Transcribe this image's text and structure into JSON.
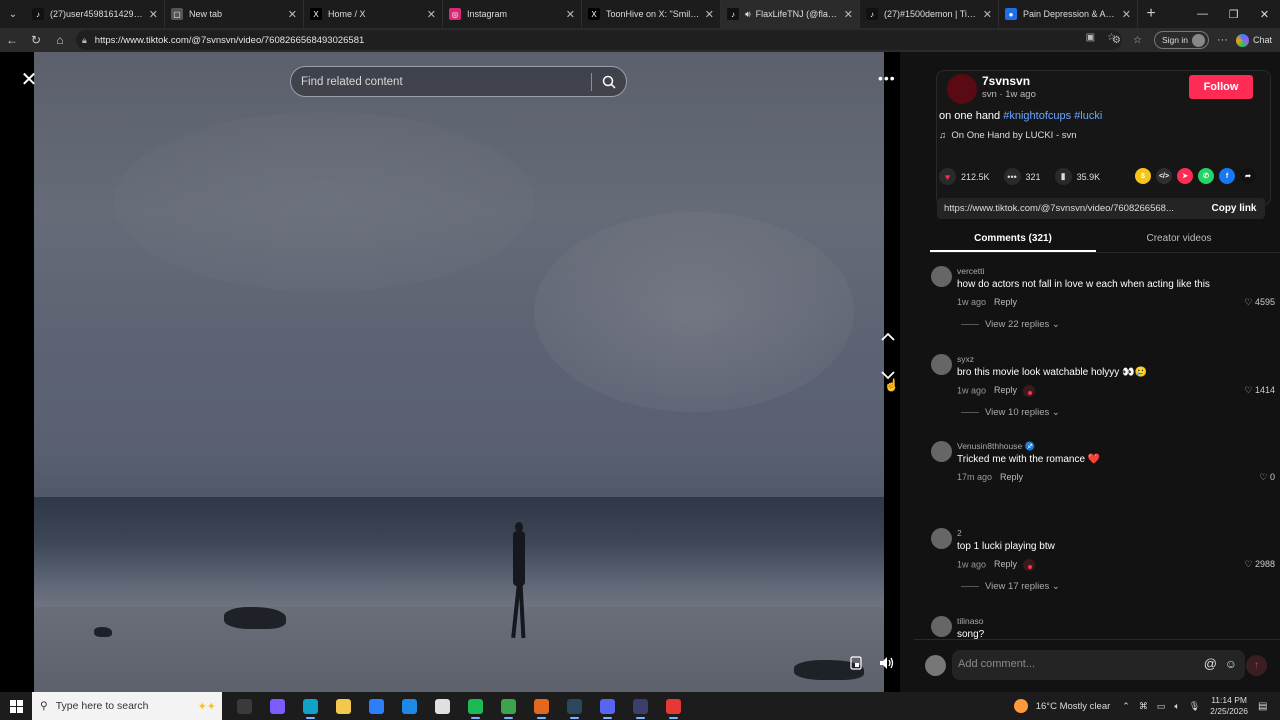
{
  "browser": {
    "tabs": [
      {
        "title": "(27)user4598161429655 (@u",
        "icon": "tiktok-icon",
        "color": "#111111",
        "glyph": "♪",
        "active": false
      },
      {
        "title": "New tab",
        "icon": "page-icon",
        "color": "#555555",
        "glyph": "▢",
        "active": false
      },
      {
        "title": "Home / X",
        "icon": "x-icon",
        "color": "#000000",
        "glyph": "X",
        "active": false
      },
      {
        "title": "Instagram",
        "icon": "instagram-icon",
        "color": "#d62976",
        "glyph": "◎",
        "active": false
      },
      {
        "title": "ToonHive on X: \"Smiling Fri",
        "icon": "x-icon",
        "color": "#000000",
        "glyph": "X",
        "active": false
      },
      {
        "title": "FlaxLifeTNJ (@flaxlifetnj",
        "icon": "tiktok-icon",
        "color": "#111111",
        "glyph": "♪",
        "active": true
      },
      {
        "title": "(27)#1500demon | TikTok",
        "icon": "tiktok-icon",
        "color": "#111111",
        "glyph": "♪",
        "active": false
      },
      {
        "title": "Pain Depression & Anxiety o",
        "icon": "generic-icon",
        "color": "#1f6feb",
        "glyph": "●",
        "active": false
      }
    ],
    "url": "https://www.tiktok.com/@7svnsvn/video/7608266568493026581",
    "signin_label": "Sign in",
    "chat_label": "Chat"
  },
  "video": {
    "search_placeholder": "Find related content"
  },
  "post": {
    "username": "7svnsvn",
    "subtitle": "svn · 1w ago",
    "follow_label": "Follow",
    "caption_text": "on one hand ",
    "hashtags": [
      "#knightofcups",
      "#lucki"
    ],
    "music": "On One Hand by LUCKI - svn",
    "likes": "212.5K",
    "comments": "321",
    "saves": "35.9K",
    "link": "https://www.tiktok.com/@7svnsvn/video/7608266568...",
    "copy_label": "Copy link",
    "share_icons": [
      {
        "name": "tiktok-coin-icon",
        "color": "#f5c518",
        "glyph": "$"
      },
      {
        "name": "embed-icon",
        "color": "#2f2f2f",
        "glyph": "</>"
      },
      {
        "name": "send-icon",
        "color": "#fe2c55",
        "glyph": "➤"
      },
      {
        "name": "whatsapp-icon",
        "color": "#25d366",
        "glyph": "✆"
      },
      {
        "name": "facebook-icon",
        "color": "#1877f2",
        "glyph": "f"
      },
      {
        "name": "share-arrow-icon",
        "color": "#121212",
        "glyph": "➦"
      }
    ]
  },
  "panel_tabs": [
    "Comments (321)",
    "Creator videos"
  ],
  "comments": [
    {
      "user": "vercetti",
      "text": "how do actors not fall in love w each when acting like this",
      "time": "1w ago",
      "reply": "Reply",
      "likes": "4595",
      "view_replies": "View 22 replies",
      "author_liked": false
    },
    {
      "user": "syxz",
      "text": "bro this movie look watchable holyyy 👀🥲",
      "time": "1w ago",
      "reply": "Reply",
      "likes": "1414",
      "view_replies": "View 10 replies",
      "author_liked": true
    },
    {
      "user": "Venusin8thhouse ♐",
      "text": "Tricked me with the romance ❤️",
      "time": "17m ago",
      "reply": "Reply",
      "likes": "0",
      "view_replies": "",
      "author_liked": false
    },
    {
      "user": "2",
      "text": "top 1 lucki playing btw",
      "time": "1w ago",
      "reply": "Reply",
      "likes": "2988",
      "view_replies": "View 17 replies",
      "author_liked": true
    },
    {
      "user": "tilinaso",
      "text": "song?",
      "time": "",
      "reply": "",
      "likes": "",
      "view_replies": "",
      "author_liked": false
    }
  ],
  "add_comment_placeholder": "Add comment...",
  "taskbar": {
    "search_placeholder": "Type here to search",
    "apps": [
      {
        "name": "task-view-icon",
        "color": "#3a3a3a",
        "running": false
      },
      {
        "name": "copilot-icon",
        "color": "#7c5cff",
        "running": false
      },
      {
        "name": "edge-icon",
        "color": "#0fa3c7",
        "running": true
      },
      {
        "name": "file-explorer-icon",
        "color": "#f2c94c",
        "running": false
      },
      {
        "name": "store-icon",
        "color": "#2d7ff9",
        "running": false
      },
      {
        "name": "mail-icon",
        "color": "#1e88e5",
        "running": false
      },
      {
        "name": "notepad-icon",
        "color": "#e0e0e0",
        "running": false
      },
      {
        "name": "spotify-icon",
        "color": "#1db954",
        "running": true
      },
      {
        "name": "xbox-icon",
        "color": "#3fa34d",
        "running": true
      },
      {
        "name": "game-icon",
        "color": "#e2671f",
        "running": true
      },
      {
        "name": "steam-icon",
        "color": "#2a475e",
        "running": true
      },
      {
        "name": "discord-icon",
        "color": "#5865f2",
        "running": true
      },
      {
        "name": "app-icon",
        "color": "#3a3f6b",
        "running": true
      },
      {
        "name": "record-icon",
        "color": "#e53935",
        "running": true
      }
    ],
    "weather": "16°C  Mostly clear",
    "time": "11:14 PM",
    "date": "2/25/2026"
  }
}
